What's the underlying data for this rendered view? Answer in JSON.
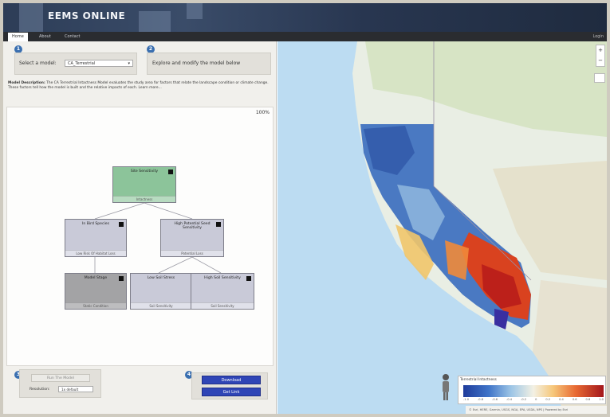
{
  "app": {
    "title": "EEMS ONLINE"
  },
  "tabs": [
    {
      "label": "Home",
      "active": true
    },
    {
      "label": "About",
      "active": false
    },
    {
      "label": "Contact",
      "active": false
    }
  ],
  "tabbar_right": "Login",
  "step1": {
    "number": "1",
    "label": "Select a model:",
    "selected_model": "CA_Terrestrial"
  },
  "step2": {
    "number": "2",
    "label": "Explore and modify the model below"
  },
  "description": {
    "label": "Model Description:",
    "text": "The CA Terrestrial Intactness Model evaluates the study area for factors that relate the landscape condition or climate change. These factors tell how the model is built and the relative impacts of each. Learn more...",
    "link": "Learn more..."
  },
  "diagram": {
    "zoom_level": "100%",
    "nodes": {
      "root": {
        "name": "Site Sensitivity",
        "sub": "Intactness"
      },
      "left": {
        "name": "In Bird Species",
        "sub": "Low Risk Of Habitat Loss"
      },
      "right": {
        "name": "High Potential Seed Sensitivity",
        "sub": "Potential Loss"
      },
      "bl": {
        "name": "Model Stage",
        "sub": "Static Condition"
      },
      "bm": {
        "name": "Low Soil Stress",
        "sub": "Soil Sensitivity"
      },
      "br": {
        "name": "High Soil Sensitivity",
        "sub": "Soil Sensitivity"
      }
    }
  },
  "step3": {
    "number": "3",
    "run_button": "Run The Model",
    "resolution_label": "Resolution:",
    "resolution_value": "1x default"
  },
  "step4": {
    "number": "4",
    "download_button": "Download",
    "share_button": "Get Link"
  },
  "map": {
    "legend_title": "Terrestrial Intactness",
    "legend_ticks": [
      "-1.0",
      "-0.8",
      "-0.6",
      "-0.4",
      "-0.2",
      "0",
      "0.2",
      "0.4",
      "0.6",
      "0.8",
      "1.0"
    ],
    "attribution": "© Esri, HERE, Garmin, USGS, NGA, EPA, USDA, NPS | Powered by Esri",
    "colors": {
      "low": "#1f3b9b",
      "mid": "#f3f1e4",
      "high": "#a3161b"
    }
  }
}
